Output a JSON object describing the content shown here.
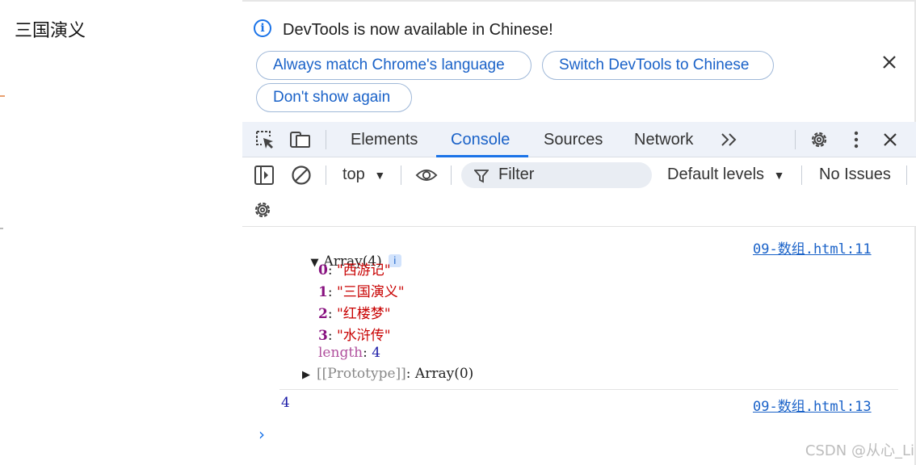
{
  "page": {
    "heading": "三国演义"
  },
  "infobar": {
    "message": "DevTools is now available in Chinese!",
    "buttons": {
      "match_language": "Always match Chrome's language",
      "switch_chinese": "Switch DevTools to Chinese",
      "dont_show": "Don't show again"
    }
  },
  "main_toolbar": {
    "tabs": {
      "elements": "Elements",
      "console": "Console",
      "sources": "Sources",
      "network": "Network"
    },
    "active_tab": "Console"
  },
  "console_toolbar": {
    "context": "top",
    "filter_placeholder": "Filter",
    "levels": "Default levels",
    "issues": "No Issues"
  },
  "console": {
    "array_label": "Array(4)",
    "array_link": "09-数组.html:11",
    "items": [
      {
        "index": "0",
        "value": "\"西游记\""
      },
      {
        "index": "1",
        "value": "\"三国演义\""
      },
      {
        "index": "2",
        "value": "\"红楼梦\""
      },
      {
        "index": "3",
        "value": "\"水浒传\""
      }
    ],
    "length_key": "length",
    "length_value": "4",
    "prototype_key": "[[Prototype]]",
    "prototype_value": "Array(0)",
    "log2_value": "4",
    "log2_link": "09-数组.html:13"
  },
  "watermark": "CSDN @从心_Li",
  "colors": {
    "accent": "#1a73e8",
    "toolbar_bg": "#eef2f9",
    "string": "#c80000",
    "key": "#881280"
  }
}
